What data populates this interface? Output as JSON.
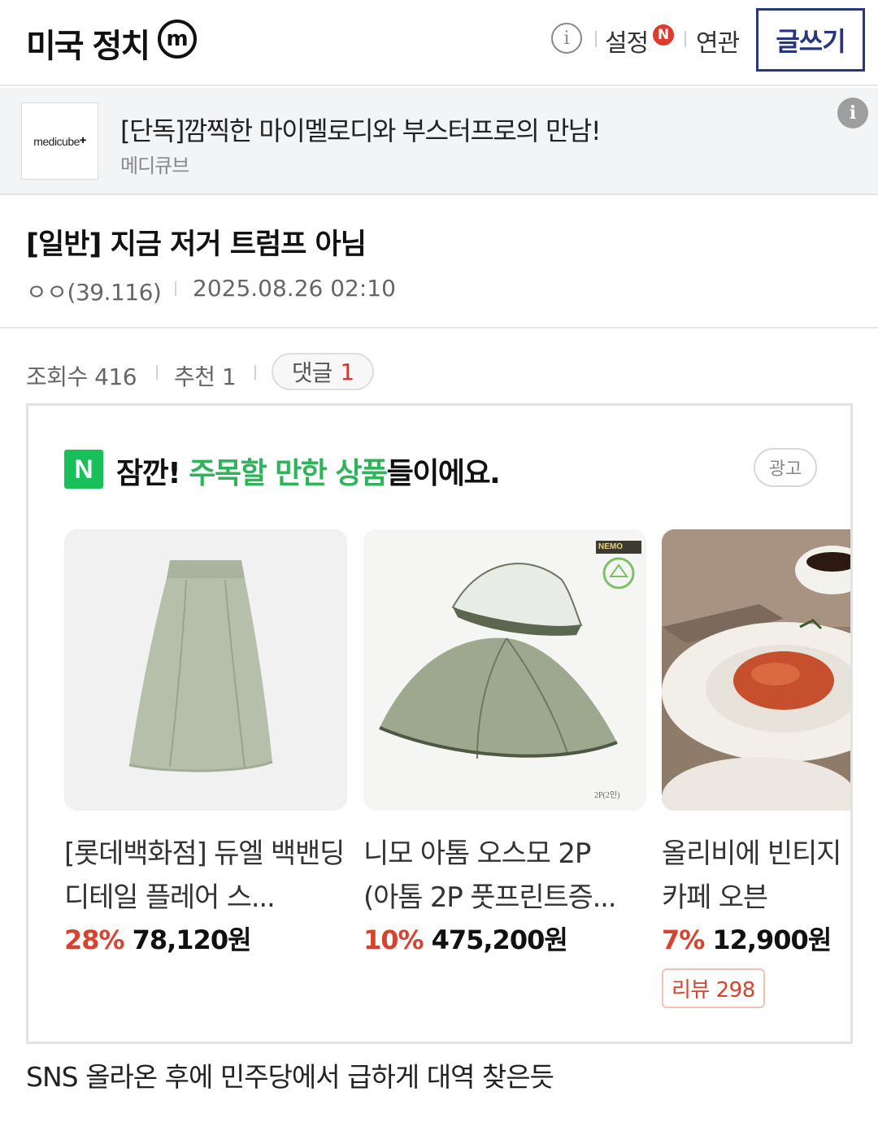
{
  "header": {
    "gallery_title": "미국 정치",
    "badge_letter": "m",
    "info_icon": "i",
    "settings_label": "설정",
    "settings_new_badge": "N",
    "related_label": "연관",
    "write_button_label": "글쓰기"
  },
  "ad_banner": {
    "logo_text": "medicube",
    "title": "[단독]깜찍한 마이멜로디와 부스터프로의 만남!",
    "advertiser": "메디큐브",
    "info_icon": "i"
  },
  "post": {
    "title": "[일반] 지금 저거 트럼프 아님",
    "author": "ㅇㅇ(39.116)",
    "date": "2025.08.26 02:10",
    "views_label": "조회수 416",
    "likes_label": "추천 1",
    "comments_label": "댓글",
    "comments_count": "1",
    "body": "SNS 올라온 후에 민주당에서 급하게 대역 찾은듯"
  },
  "product_ad": {
    "logo_letter": "N",
    "promo_prefix": "잠깐! ",
    "promo_highlight": "주목할 만한 상품",
    "promo_suffix": "들이에요.",
    "ad_tag": "광고",
    "products": [
      {
        "name": "[롯데백화점] 듀엘 백밴딩 디테일 플레어 스...",
        "discount": "28%",
        "price": "78,120원",
        "image_icon": "skirt-image"
      },
      {
        "name": "니모 아톰 오스모 2P (아톰 2P 풋프린트증...",
        "discount": "10%",
        "price": "475,200원",
        "image_icon": "tent-image",
        "brand_tag": "NEMO",
        "size_label": "2P(2인)"
      },
      {
        "name": "올리비에 빈티지 팅 홈 카페 오븐",
        "discount": "7%",
        "price": "12,900원",
        "review": "리뷰 298",
        "image_icon": "pasta-plate-image"
      }
    ]
  },
  "colors": {
    "brand_navy": "#29367c",
    "naver_green": "#19c05a",
    "highlight_green": "#2fb45b",
    "discount_red": "#d8432f"
  }
}
